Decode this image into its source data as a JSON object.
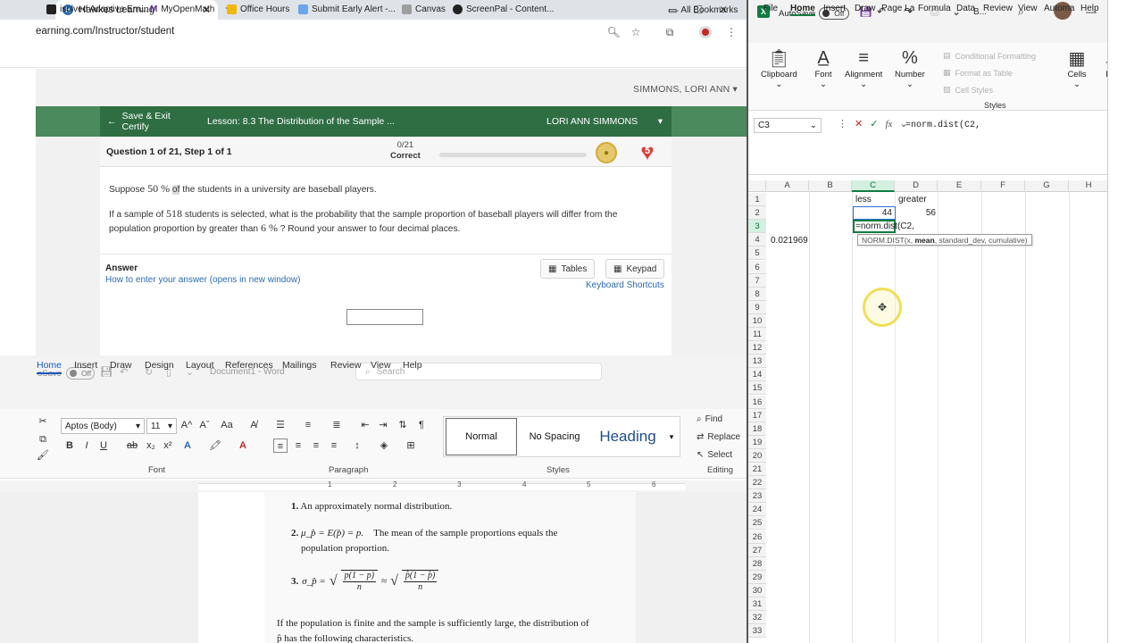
{
  "browser": {
    "tab_title": "Hawkes Learning",
    "url": "earning.com/Instructor/student",
    "bookmarks": [
      "isolved Adaptive Em...",
      "MyOpenMath",
      "Office Hours",
      "Submit Early Alert -...",
      "Canvas",
      "ScreenPal - Content..."
    ],
    "all_bookmarks": "All Bookmarks",
    "user_name": "SIMMONS, LORI ANN",
    "save_exit": "Save & Exit Certify",
    "lesson": "Lesson: 8.3 The Distribution of the Sample ...",
    "learner": "LORI ANN SIMMONS",
    "question_title": "Question 1 of 21, Step 1 of 1",
    "score_fraction": "0/21",
    "score_label": "Correct",
    "hearts": "5",
    "question": {
      "p1_pre": "Suppose",
      "p1_num": "50 %",
      "p1_of": "of",
      "p1_post": "the students in a university are baseball players.",
      "p2_pre": "If a sample of",
      "p2_num": "518",
      "p2_mid": "students is selected, what is the probability that the sample proportion of baseball players will differ from the",
      "p2_line2_pre": "population proportion by greater than",
      "p2_pct": "6 %",
      "p2_post": "? Round your answer to four decimal places."
    },
    "answer_label": "Answer",
    "answer_link": "How to enter your answer (opens in new window)",
    "tables_label": "Tables",
    "keypad_label": "Keypad",
    "keyboard_shortcuts": "Keyboard Shortcuts"
  },
  "word": {
    "autosave": "oSave",
    "autosave_state": "Off",
    "doc_title": "Document1 - Word",
    "search_placeholder": "Search",
    "tabs": [
      "Home",
      "Insert",
      "Draw",
      "Design",
      "Layout",
      "References",
      "Mailings",
      "Review",
      "View",
      "Help"
    ],
    "font_name": "Aptos (Body)",
    "font_size": "11",
    "groups": {
      "font": "Font",
      "paragraph": "Paragraph",
      "styles": "Styles",
      "editing": "Editing"
    },
    "styles": [
      "Normal",
      "No Spacing",
      "Heading"
    ],
    "editing": [
      "Find",
      "Replace",
      "Select"
    ],
    "ruler_numbers": [
      "1",
      "2",
      "3",
      "4",
      "5",
      "6"
    ],
    "doc": {
      "item1_num": "1.",
      "item1": "An approximately normal distribution.",
      "item2_num": "2.",
      "item2_math": "μ_p̂ = E(p̂) = p.",
      "item2_text": "The mean of the sample proportions equals the",
      "item2_text2": "population proportion.",
      "item3_num": "3.",
      "item3_lhs": "σ_p̂ =",
      "item3_frac1_top": "p(1 − p)",
      "item3_frac1_bot": "n",
      "item3_approx": "≈",
      "item3_frac2_top": "p̂(1 − p̂)",
      "item3_frac2_bot": "n",
      "para1": "If the population is finite and the sample is sufficiently large, the distribution of",
      "para2": "p̂ has the following characteristics."
    }
  },
  "excel": {
    "autosave": "AutoSave",
    "autosave_state": "Off",
    "book": "B...",
    "tabs": [
      "File",
      "Home",
      "Insert",
      "Draw",
      "Page La",
      "Formula",
      "Data",
      "Review",
      "View",
      "Automa",
      "Help"
    ],
    "ribbon_groups": [
      "Clipboard",
      "Font",
      "Alignment",
      "Number",
      "Cells",
      "Ed"
    ],
    "styles_items": [
      "Conditional Formatting",
      "Format as Table",
      "Cell Styles"
    ],
    "styles_label": "Styles",
    "name_box": "C3",
    "formula": "=norm.dist(C2,",
    "columns": [
      "A",
      "B",
      "C",
      "D",
      "E",
      "F",
      "G",
      "H"
    ],
    "rows": [
      "1",
      "2",
      "3",
      "4",
      "5",
      "6",
      "7",
      "8",
      "9",
      "10",
      "11",
      "12",
      "13",
      "14",
      "15",
      "16",
      "17",
      "18",
      "19",
      "20",
      "21",
      "22",
      "23",
      "24",
      "25",
      "26",
      "27",
      "28",
      "29",
      "30",
      "31",
      "32",
      "33"
    ],
    "cells": {
      "C1": "less",
      "D1": "greater",
      "C2": "44",
      "D2": "56",
      "C3": "=norm.dist(C2,",
      "A4": "0.021969"
    },
    "tooltip_fn": "NORM.DIST(x, ",
    "tooltip_bold": "mean",
    "tooltip_rest": ", standard_dev, cumulative)"
  }
}
